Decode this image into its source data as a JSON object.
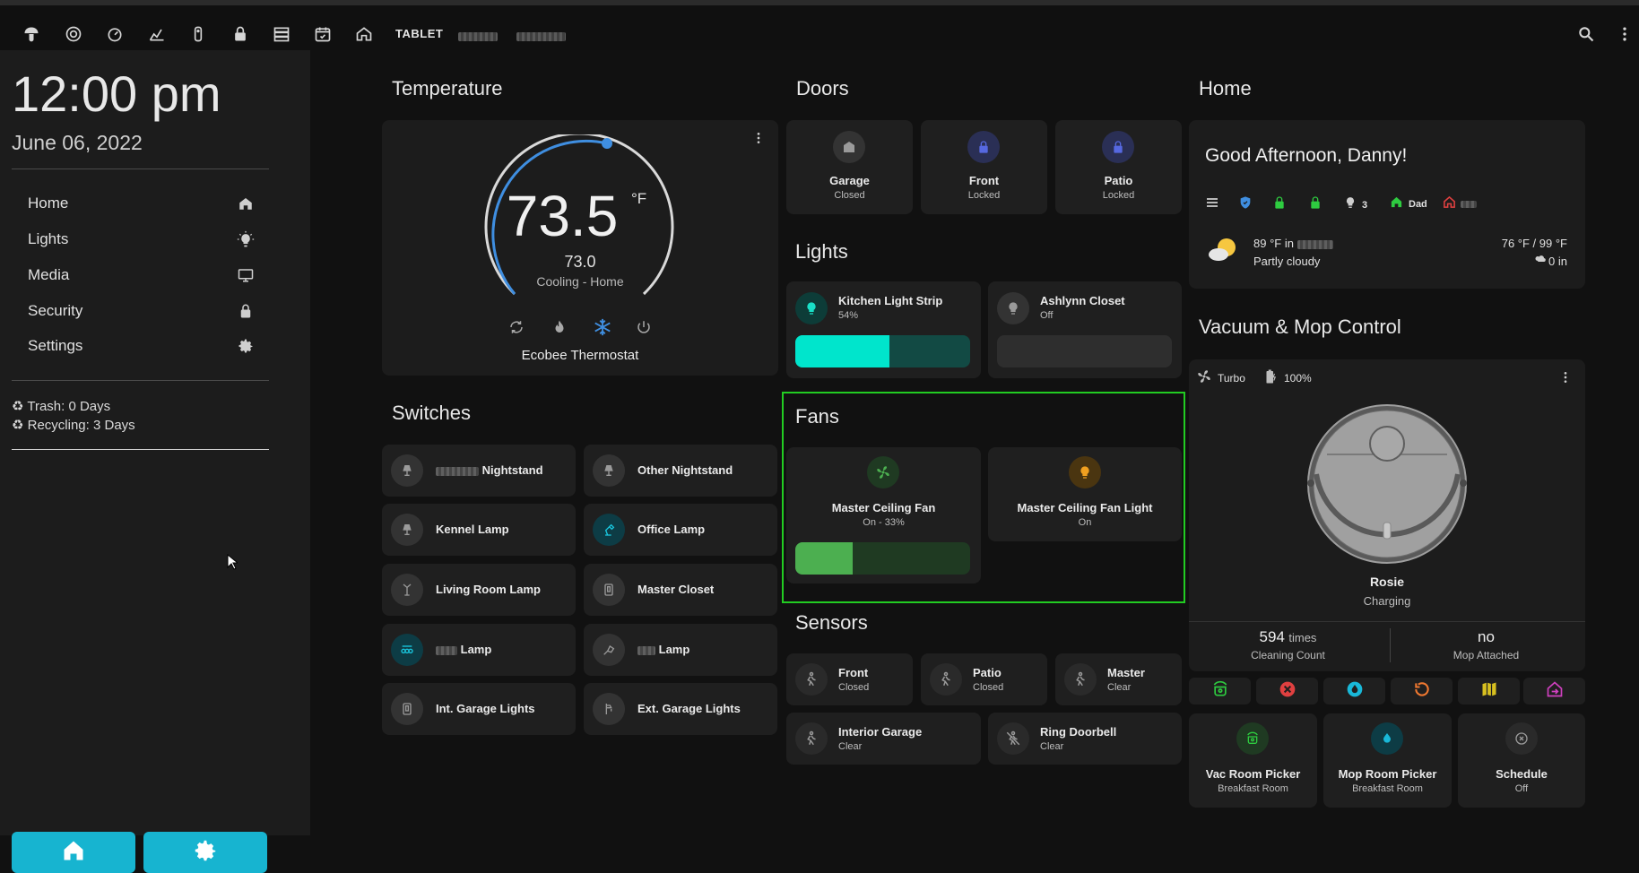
{
  "topbar": {
    "tab_label": "TABLET",
    "icons": [
      "mushroom-icon",
      "robot-icon",
      "gauge-icon",
      "chart-icon",
      "remote-icon",
      "lock-icon",
      "server-icon",
      "calendar-icon",
      "home-icon"
    ],
    "right_icons": [
      "search-icon",
      "more-vertical-icon"
    ]
  },
  "sidebar": {
    "time": "12:00 pm",
    "date": "June 06, 2022",
    "nav": [
      {
        "label": "Home",
        "icon": "home-icon"
      },
      {
        "label": "Lights",
        "icon": "lightbulb-icon"
      },
      {
        "label": "Media",
        "icon": "monitor-icon"
      },
      {
        "label": "Security",
        "icon": "lock-icon"
      },
      {
        "label": "Settings",
        "icon": "gear-icon"
      }
    ],
    "trash": "♻ Trash: 0 Days",
    "recycling": "♻ Recycling: 3 Days"
  },
  "temperature": {
    "title": "Temperature",
    "current": "73.5",
    "unit": "°F",
    "target": "73.0",
    "mode": "Cooling - Home",
    "name": "Ecobee Thermostat",
    "modes": [
      "auto-icon",
      "heat-icon",
      "cool-icon",
      "power-icon"
    ]
  },
  "doors": {
    "title": "Doors",
    "items": [
      {
        "name": "Garage",
        "state": "Closed"
      },
      {
        "name": "Front",
        "state": "Locked"
      },
      {
        "name": "Patio",
        "state": "Locked"
      }
    ]
  },
  "lights": {
    "title": "Lights",
    "items": [
      {
        "name": "Kitchen Light Strip",
        "state": "54%",
        "level": 0.54
      },
      {
        "name": "Ashlynn Closet",
        "state": "Off",
        "level": 0
      }
    ]
  },
  "fans": {
    "title": "Fans",
    "items": [
      {
        "name": "Master Ceiling Fan",
        "state": "On - 33%",
        "level": 0.33
      },
      {
        "name": "Master Ceiling Fan Light",
        "state": "On"
      }
    ]
  },
  "switches": {
    "title": "Switches",
    "items": [
      "Nightstand",
      "Other Nightstand",
      "Kennel Lamp",
      "Office Lamp",
      "Living Room Lamp",
      "Master Closet",
      "Lamp",
      "Lamp",
      "Int. Garage Lights",
      "Ext. Garage Lights"
    ]
  },
  "sensors": {
    "title": "Sensors",
    "items": [
      {
        "name": "Front",
        "state": "Closed"
      },
      {
        "name": "Patio",
        "state": "Closed"
      },
      {
        "name": "Master",
        "state": "Clear"
      },
      {
        "name": "Interior Garage",
        "state": "Clear"
      },
      {
        "name": "Ring Doorbell",
        "state": "Clear"
      }
    ]
  },
  "home": {
    "title": "Home",
    "greeting": "Good Afternoon, Danny!",
    "chips": {
      "lights_count": "3",
      "person": "Dad"
    },
    "weather": {
      "temp": "89 °F in",
      "condition": "Partly cloudy",
      "range": "76 °F / 99 °F",
      "precip": "0 in"
    }
  },
  "vacuum": {
    "title": "Vacuum & Mop Control",
    "fan_mode": "Turbo",
    "battery": "100%",
    "name": "Rosie",
    "status": "Charging",
    "cleaning_count": "594",
    "cleaning_unit": "times",
    "cleaning_label": "Cleaning Count",
    "mop_value": "no",
    "mop_label": "Mop Attached",
    "pickers": [
      {
        "name": "Vac Room Picker",
        "state": "Breakfast Room"
      },
      {
        "name": "Mop Room Picker",
        "state": "Breakfast Room"
      },
      {
        "name": "Schedule",
        "state": "Off"
      }
    ]
  },
  "colors": {
    "accent": "#17b4d0",
    "fan_green": "#4caf50",
    "light_teal": "#00e5cc",
    "frame_green": "#22cc22",
    "lock_blue": "#4a5ccc"
  }
}
